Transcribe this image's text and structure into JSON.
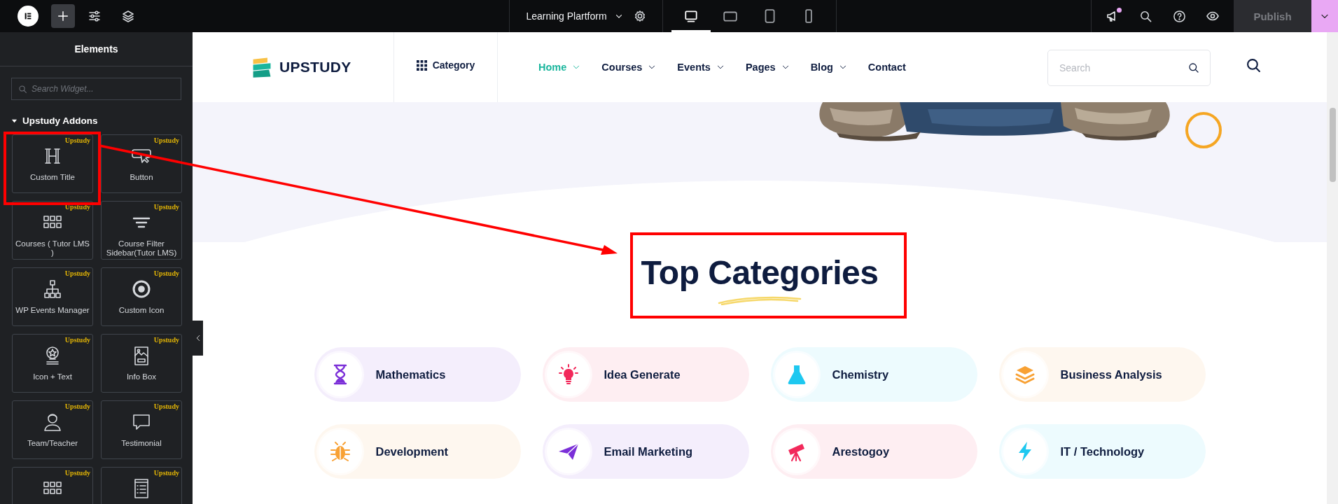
{
  "toolbar": {
    "has_notification": true,
    "page_title": "Learning Plartform",
    "devices": [
      {
        "selected": true
      },
      {
        "selected": false
      },
      {
        "selected": false
      },
      {
        "selected": false
      }
    ],
    "publish": {
      "label": "Publish",
      "disabled": true
    }
  },
  "sidebar": {
    "title": "Elements",
    "search": {
      "placeholder": "Search Widget..."
    },
    "section": {
      "title": "Upstudy Addons",
      "expanded": true,
      "widgets": [
        {
          "label": "Custom Title",
          "badge": "Upstudy"
        },
        {
          "label": "Button",
          "badge": "Upstudy"
        },
        {
          "label": "Courses ( Tutor LMS )",
          "badge": "Upstudy"
        },
        {
          "label": "Course Filter Sidebar(Tutor LMS)",
          "badge": "Upstudy"
        },
        {
          "label": "WP Events Manager",
          "badge": "Upstudy"
        },
        {
          "label": "Custom Icon",
          "badge": "Upstudy"
        },
        {
          "label": "Icon + Text",
          "badge": "Upstudy"
        },
        {
          "label": "Info Box",
          "badge": "Upstudy"
        },
        {
          "label": "Team/Teacher",
          "badge": "Upstudy"
        },
        {
          "label": "Testimonial",
          "badge": "Upstudy"
        },
        {
          "badge": "Upstudy"
        },
        {
          "badge": "Upstudy"
        }
      ]
    }
  },
  "site": {
    "brand": "UPSTUDY",
    "category_button": "Category",
    "nav": [
      {
        "label": "Home",
        "selected": true,
        "dropdown": true
      },
      {
        "label": "Courses",
        "selected": false,
        "dropdown": true
      },
      {
        "label": "Events",
        "selected": false,
        "dropdown": true
      },
      {
        "label": "Pages",
        "selected": false,
        "dropdown": true
      },
      {
        "label": "Blog",
        "selected": false,
        "dropdown": true
      },
      {
        "label": "Contact",
        "selected": false,
        "dropdown": false
      }
    ],
    "search": {
      "placeholder": "Search"
    }
  },
  "categories": {
    "title": "Top Categories",
    "items": [
      {
        "label": "Mathematics",
        "color": "#7b2fd8"
      },
      {
        "label": "Idea Generate",
        "color": "#f2295b"
      },
      {
        "label": "Chemistry",
        "color": "#1ec8f0"
      },
      {
        "label": "Business Analysis",
        "color": "#f8a134"
      },
      {
        "label": "Development",
        "color": "#f8a134"
      },
      {
        "label": "Email Marketing",
        "color": "#7b2fd8"
      },
      {
        "label": "Arestogoy",
        "color": "#f2295b"
      },
      {
        "label": "IT / Technology",
        "color": "#1ec8f0"
      }
    ]
  }
}
